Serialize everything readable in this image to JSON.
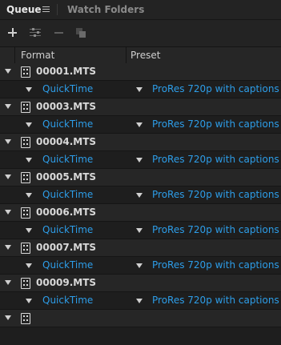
{
  "tabs": {
    "queue": "Queue",
    "watch_folders": "Watch Folders"
  },
  "columns": {
    "format": "Format",
    "preset": "Preset"
  },
  "items": [
    {
      "name": "00001.MTS",
      "format": "QuickTime",
      "preset": "ProRes 720p with captions"
    },
    {
      "name": "00003.MTS",
      "format": "QuickTime",
      "preset": "ProRes 720p with captions"
    },
    {
      "name": "00004.MTS",
      "format": "QuickTime",
      "preset": "ProRes 720p with captions"
    },
    {
      "name": "00005.MTS",
      "format": "QuickTime",
      "preset": "ProRes 720p with captions"
    },
    {
      "name": "00006.MTS",
      "format": "QuickTime",
      "preset": "ProRes 720p with captions"
    },
    {
      "name": "00007.MTS",
      "format": "QuickTime",
      "preset": "ProRes 720p with captions"
    },
    {
      "name": "00009.MTS",
      "format": "QuickTime",
      "preset": "ProRes 720p with captions"
    }
  ],
  "colors": {
    "link": "#2d9de8",
    "background": "#1e1e1e"
  },
  "icons": {
    "add": "plus-icon",
    "settings": "sliders-icon",
    "remove": "minus-icon",
    "duplicate": "duplicate-icon",
    "source": "film-icon"
  }
}
